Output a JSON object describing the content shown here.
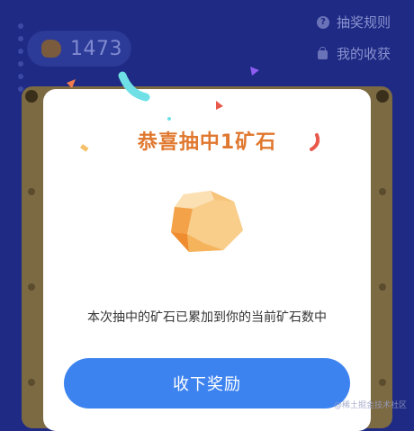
{
  "balance": {
    "count": "1473",
    "icon": "ore-icon"
  },
  "top_links": {
    "rules_label": "抽奖规则",
    "rules_icon": "question-circle-icon",
    "prizes_label": "我的收获",
    "prizes_icon": "bag-icon"
  },
  "dialog": {
    "title": "恭喜抽中1矿石",
    "message": "本次抽中的矿石已累加到你的当前矿石数中",
    "button_label": "收下奖励",
    "prize_icon": "ore-icon"
  },
  "watermark": "@稀土掘金技术社区",
  "colors": {
    "background": "#1e2a83",
    "title": "#e0782f",
    "button": "#3d83f0",
    "board": "#7c6a43"
  }
}
